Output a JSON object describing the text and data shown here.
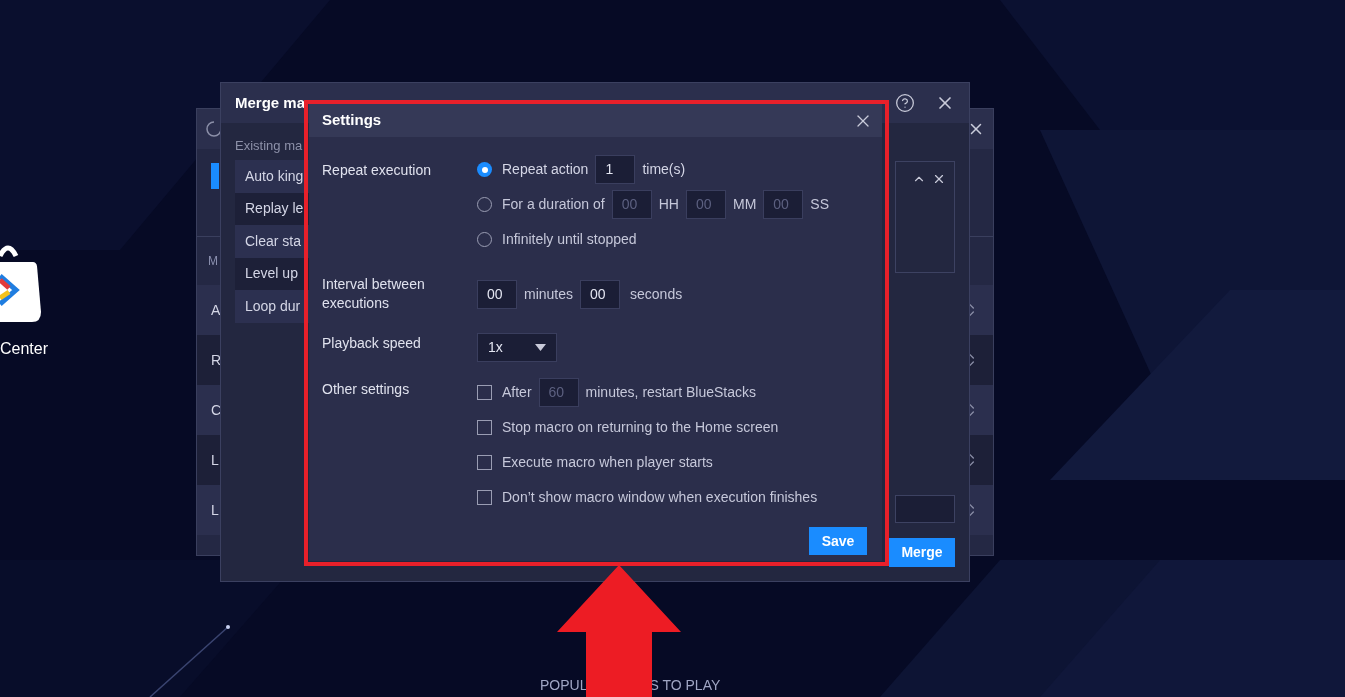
{
  "desktop": {
    "app_label": "Center",
    "footer_texts": [
      "POPUL",
      "S TO PLAY"
    ]
  },
  "back_window": {
    "column_header": "M",
    "rows": [
      {
        "label": "A"
      },
      {
        "label": "R"
      },
      {
        "label": "C"
      },
      {
        "label": "L"
      },
      {
        "label": "L"
      }
    ]
  },
  "merge_window": {
    "title": "Merge ma",
    "existing_label": "Existing ma",
    "macros": [
      {
        "name": "Auto king"
      },
      {
        "name": "Replay le"
      },
      {
        "name": "Clear sta"
      },
      {
        "name": "Level up"
      },
      {
        "name": "Loop dur"
      }
    ],
    "merge_button": "Merge"
  },
  "settings": {
    "title": "Settings",
    "repeat": {
      "label": "Repeat execution",
      "options": [
        {
          "kind": "count",
          "selected": true,
          "label": "Repeat action",
          "value": "1",
          "suffix": "time(s)"
        },
        {
          "kind": "duration",
          "selected": false,
          "label": "For a duration of",
          "fields": [
            {
              "value": "00",
              "unit": "HH"
            },
            {
              "value": "00",
              "unit": "MM"
            },
            {
              "value": "00",
              "unit": "SS"
            }
          ]
        },
        {
          "kind": "plain",
          "selected": false,
          "label": "Infinitely until stopped"
        }
      ]
    },
    "interval": {
      "label": "Interval between executions",
      "minutes": "00",
      "minutes_unit": "minutes",
      "seconds": "00",
      "seconds_unit": "seconds"
    },
    "playback": {
      "label": "Playback speed",
      "value": "1x"
    },
    "other": {
      "label": "Other settings",
      "options": [
        {
          "kind": "restart",
          "checked": false,
          "before": "After",
          "value": "60",
          "after": "minutes, restart BlueStacks"
        },
        {
          "kind": "plain",
          "checked": false,
          "label": "Stop macro on returning to the Home screen"
        },
        {
          "kind": "plain",
          "checked": false,
          "label": "Execute macro when player starts"
        },
        {
          "kind": "plain",
          "checked": false,
          "label": "Don’t show macro window when execution finishes"
        }
      ]
    },
    "save_button": "Save"
  }
}
